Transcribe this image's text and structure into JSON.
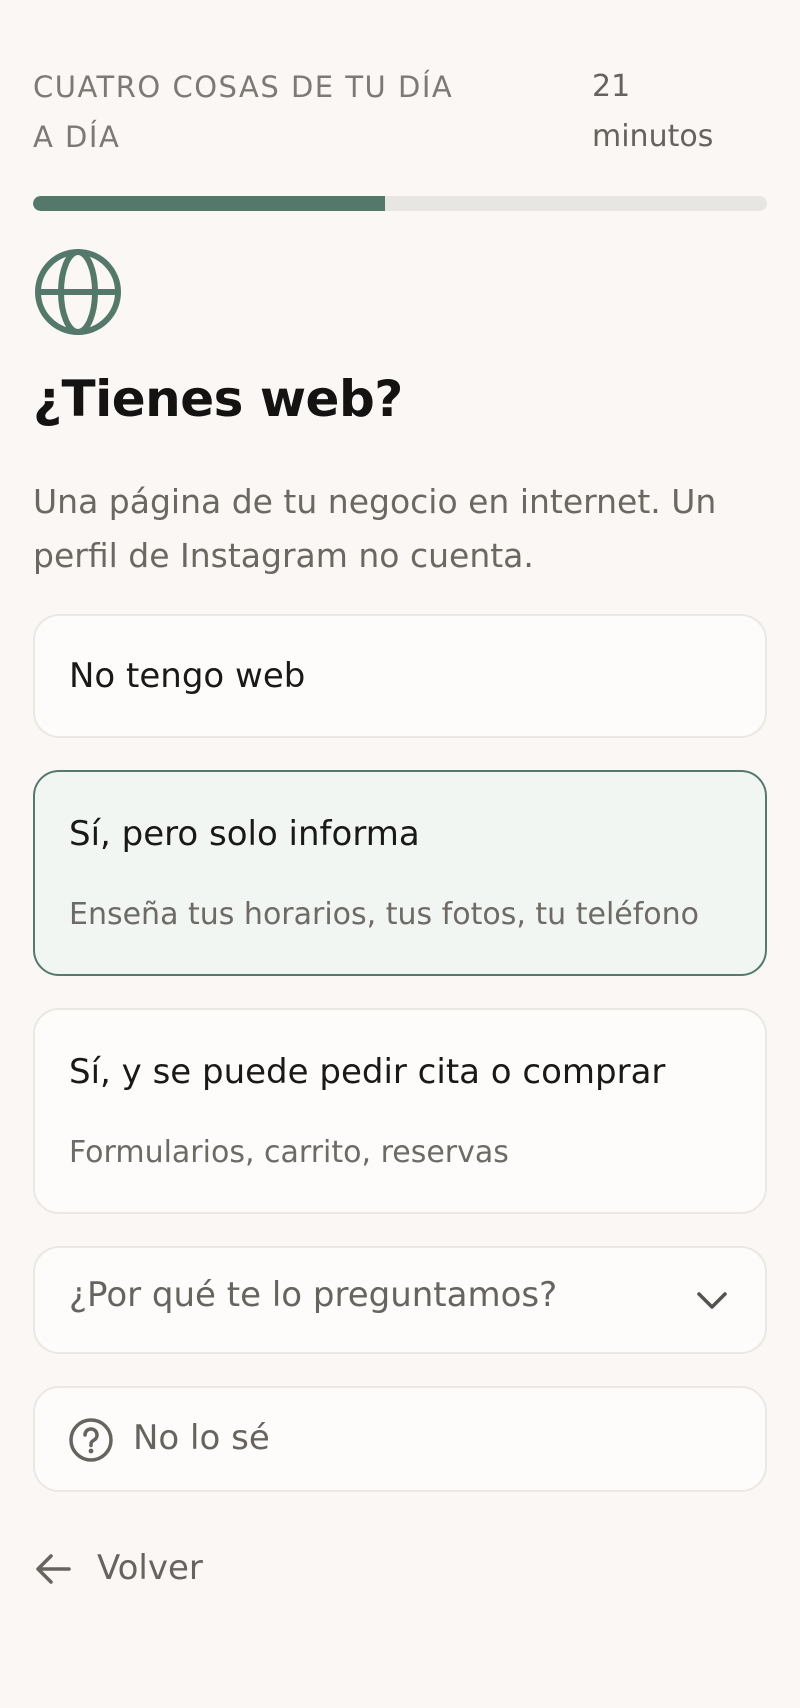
{
  "header": {
    "section_title": "CUATRO COSAS DE TU DÍA A DÍA",
    "time_value": "21",
    "time_unit": "minutos"
  },
  "progress": {
    "fraction": 0.48,
    "color": "#54796a"
  },
  "question": {
    "icon": "globe-icon",
    "title": "¿Tienes web?",
    "description": "Una página de tu negocio en internet. Un perfil de Instagram no cuenta."
  },
  "options": [
    {
      "label": "No tengo web",
      "sublabel": "",
      "selected": false
    },
    {
      "label": "Sí, pero solo informa",
      "sublabel": "Enseña tus horarios, tus fotos, tu teléfono",
      "selected": true
    },
    {
      "label": "Sí, y se puede pedir cita o comprar",
      "sublabel": "Formularios, carrito, reservas",
      "selected": false
    }
  ],
  "why": {
    "label": "¿Por qué te lo preguntamos?",
    "icon": "chevron-down-icon"
  },
  "unsure": {
    "label": "No lo sé",
    "icon": "question-circle-icon"
  },
  "back": {
    "label": "Volver",
    "icon": "arrow-left-icon"
  },
  "colors": {
    "accent": "#54796a",
    "selected_bg": "#f1f6f3",
    "background": "#faf7f4"
  }
}
